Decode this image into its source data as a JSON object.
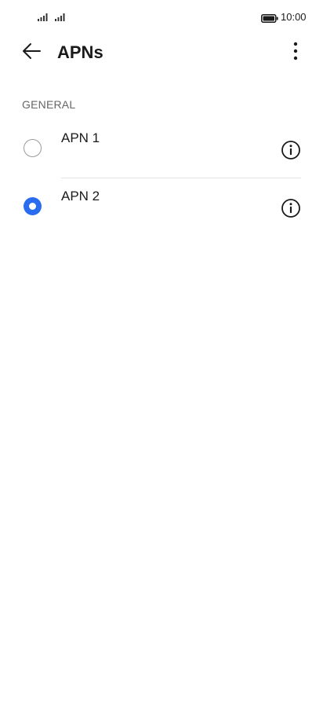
{
  "status_bar": {
    "time": "10:00",
    "icons": [
      "signal-icon",
      "signal-icon",
      "battery-icon"
    ]
  },
  "app_bar": {
    "title": "APNs",
    "back_icon": "arrow-left-icon",
    "menu_icon": "more-vertical-icon"
  },
  "section": {
    "header": "GENERAL"
  },
  "apns": [
    {
      "name": "APN 1",
      "selected": false
    },
    {
      "name": "APN 2",
      "selected": true
    }
  ],
  "colors": {
    "accent": "#2a6cf0",
    "text": "#1a1a1a",
    "secondary_text": "#666666",
    "divider": "#e2e2e2"
  }
}
